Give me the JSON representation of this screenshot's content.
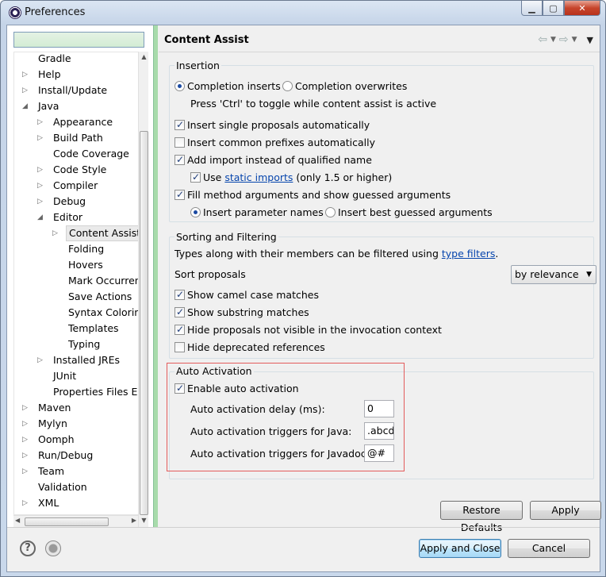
{
  "window": {
    "title": "Preferences",
    "minimize": "▁",
    "maximize": "▢",
    "close": "✕"
  },
  "filter": {
    "placeholder": "",
    "value": ""
  },
  "tree": [
    {
      "label": "Gradle",
      "depth": 0,
      "arrow": ""
    },
    {
      "label": "Help",
      "depth": 0,
      "arrow": "▷"
    },
    {
      "label": "Install/Update",
      "depth": 0,
      "arrow": "▷"
    },
    {
      "label": "Java",
      "depth": 0,
      "arrow": "◢"
    },
    {
      "label": "Appearance",
      "depth": 1,
      "arrow": "▷"
    },
    {
      "label": "Build Path",
      "depth": 1,
      "arrow": "▷"
    },
    {
      "label": "Code Coverage",
      "depth": 1,
      "arrow": ""
    },
    {
      "label": "Code Style",
      "depth": 1,
      "arrow": "▷"
    },
    {
      "label": "Compiler",
      "depth": 1,
      "arrow": "▷"
    },
    {
      "label": "Debug",
      "depth": 1,
      "arrow": "▷"
    },
    {
      "label": "Editor",
      "depth": 1,
      "arrow": "◢"
    },
    {
      "label": "Content Assist",
      "depth": 2,
      "arrow": "▷",
      "selected": true
    },
    {
      "label": "Folding",
      "depth": 2,
      "arrow": ""
    },
    {
      "label": "Hovers",
      "depth": 2,
      "arrow": ""
    },
    {
      "label": "Mark Occurren",
      "depth": 2,
      "arrow": ""
    },
    {
      "label": "Save Actions",
      "depth": 2,
      "arrow": ""
    },
    {
      "label": "Syntax Coloring",
      "depth": 2,
      "arrow": ""
    },
    {
      "label": "Templates",
      "depth": 2,
      "arrow": ""
    },
    {
      "label": "Typing",
      "depth": 2,
      "arrow": ""
    },
    {
      "label": "Installed JREs",
      "depth": 1,
      "arrow": "▷"
    },
    {
      "label": "JUnit",
      "depth": 1,
      "arrow": ""
    },
    {
      "label": "Properties Files Ed",
      "depth": 1,
      "arrow": ""
    },
    {
      "label": "Maven",
      "depth": 0,
      "arrow": "▷"
    },
    {
      "label": "Mylyn",
      "depth": 0,
      "arrow": "▷"
    },
    {
      "label": "Oomph",
      "depth": 0,
      "arrow": "▷"
    },
    {
      "label": "Run/Debug",
      "depth": 0,
      "arrow": "▷"
    },
    {
      "label": "Team",
      "depth": 0,
      "arrow": "▷"
    },
    {
      "label": "Validation",
      "depth": 0,
      "arrow": ""
    },
    {
      "label": "XML",
      "depth": 0,
      "arrow": "▷"
    }
  ],
  "page": {
    "title": "Content Assist",
    "back": "⇦",
    "forward": "⇨",
    "dropdown": "▼",
    "small_dd": "▼"
  },
  "insertion": {
    "title": "Insertion",
    "radio_inserts": "Completion inserts",
    "radio_overwrites": "Completion overwrites",
    "hint": "Press 'Ctrl' to toggle while content assist is active",
    "single_proposals": "Insert single proposals automatically",
    "common_prefixes": "Insert common prefixes automatically",
    "add_import": "Add import instead of qualified name",
    "use_prefix": "Use ",
    "static_imports": "static imports",
    "use_suffix": " (only 1.5 or higher)",
    "fill_args": "Fill method arguments and show guessed arguments",
    "insert_param_names": "Insert parameter names",
    "insert_best_guessed": "Insert best guessed arguments"
  },
  "sorting": {
    "title": "Sorting and Filtering",
    "types_prefix": "Types along with their members can be filtered using ",
    "type_filters": "type filters",
    "types_suffix": ".",
    "sort_label": "Sort proposals",
    "sort_value": "by relevance",
    "camel_case": "Show camel case matches",
    "substring": "Show substring matches",
    "hide_not_visible": "Hide proposals not visible in the invocation context",
    "hide_deprecated": "Hide deprecated references"
  },
  "auto_activation": {
    "title": "Auto Activation",
    "enable": "Enable auto activation",
    "delay_label": "Auto activation delay (ms):",
    "delay_value": "0",
    "java_label": "Auto activation triggers for Java:",
    "java_value": ".abcd",
    "javadoc_label": "Auto activation triggers for Javadoc:",
    "javadoc_value": "@#"
  },
  "buttons": {
    "restore_defaults": "Restore Defaults",
    "apply": "Apply",
    "apply_and_close": "Apply and Close",
    "cancel": "Cancel"
  },
  "footer": {
    "help": "?"
  }
}
